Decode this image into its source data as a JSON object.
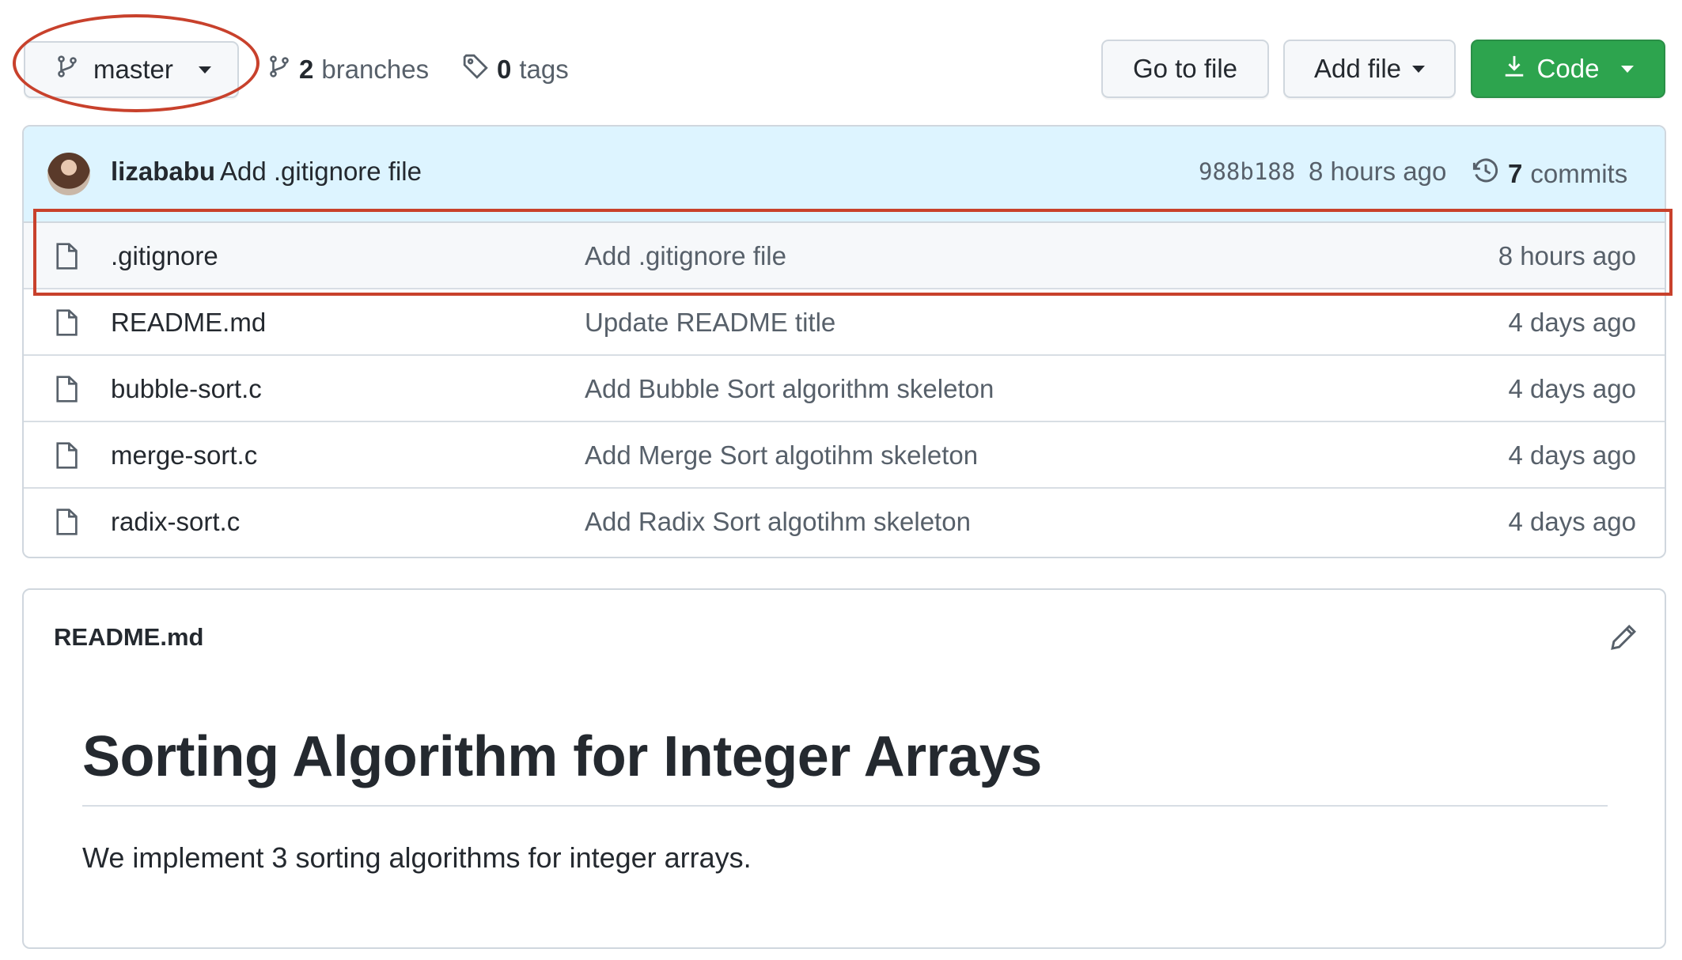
{
  "toolbar": {
    "branch_label": "master",
    "branches_count": "2",
    "branches_label": "branches",
    "tags_count": "0",
    "tags_label": "tags",
    "goto_file_label": "Go to file",
    "add_file_label": "Add file",
    "code_label": "Code"
  },
  "latest_commit": {
    "author": "lizababu",
    "message": "Add .gitignore file",
    "sha": "988b188",
    "time": "8 hours ago",
    "commits_count": "7",
    "commits_label": "commits"
  },
  "files": [
    {
      "name": ".gitignore",
      "commit": "Add .gitignore file",
      "time": "8 hours ago"
    },
    {
      "name": "README.md",
      "commit": "Update README title",
      "time": "4 days ago"
    },
    {
      "name": "bubble-sort.c",
      "commit": "Add Bubble Sort algorithm skeleton",
      "time": "4 days ago"
    },
    {
      "name": "merge-sort.c",
      "commit": "Add Merge Sort algotihm skeleton",
      "time": "4 days ago"
    },
    {
      "name": "radix-sort.c",
      "commit": "Add Radix Sort algotihm skeleton",
      "time": "4 days ago"
    }
  ],
  "readme": {
    "filename": "README.md",
    "title": "Sorting Algorithm for Integer Arrays",
    "body": "We implement 3 sorting algorithms for integer arrays."
  },
  "icons": {
    "branch": "git-branch-icon",
    "tag": "tag-icon",
    "download": "download-icon",
    "history": "history-icon",
    "file": "file-icon",
    "edit": "pencil-icon"
  },
  "colors": {
    "accent_green": "#2da44e",
    "commit_bar_bg": "#ddf4ff",
    "annotation_red": "#c8412c",
    "text_primary": "#24292f",
    "text_muted": "#57606a"
  }
}
